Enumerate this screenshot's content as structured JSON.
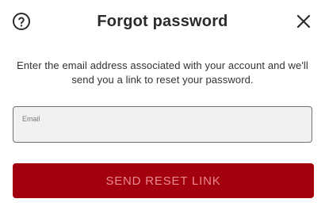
{
  "dialog": {
    "title": "Forgot password",
    "description": "Enter the email address associated with your account and we'll send you a link to reset your password.",
    "help_icon": "help-question-icon",
    "close_icon": "close-icon"
  },
  "form": {
    "email_label": "Email",
    "email_value": "",
    "submit_label": "SEND RESET LINK",
    "submit_enabled": false
  },
  "colors": {
    "primary": "#a3000e",
    "button_text_disabled": "#e88a90",
    "input_background": "#f1f1f1",
    "input_border": "#707070"
  }
}
